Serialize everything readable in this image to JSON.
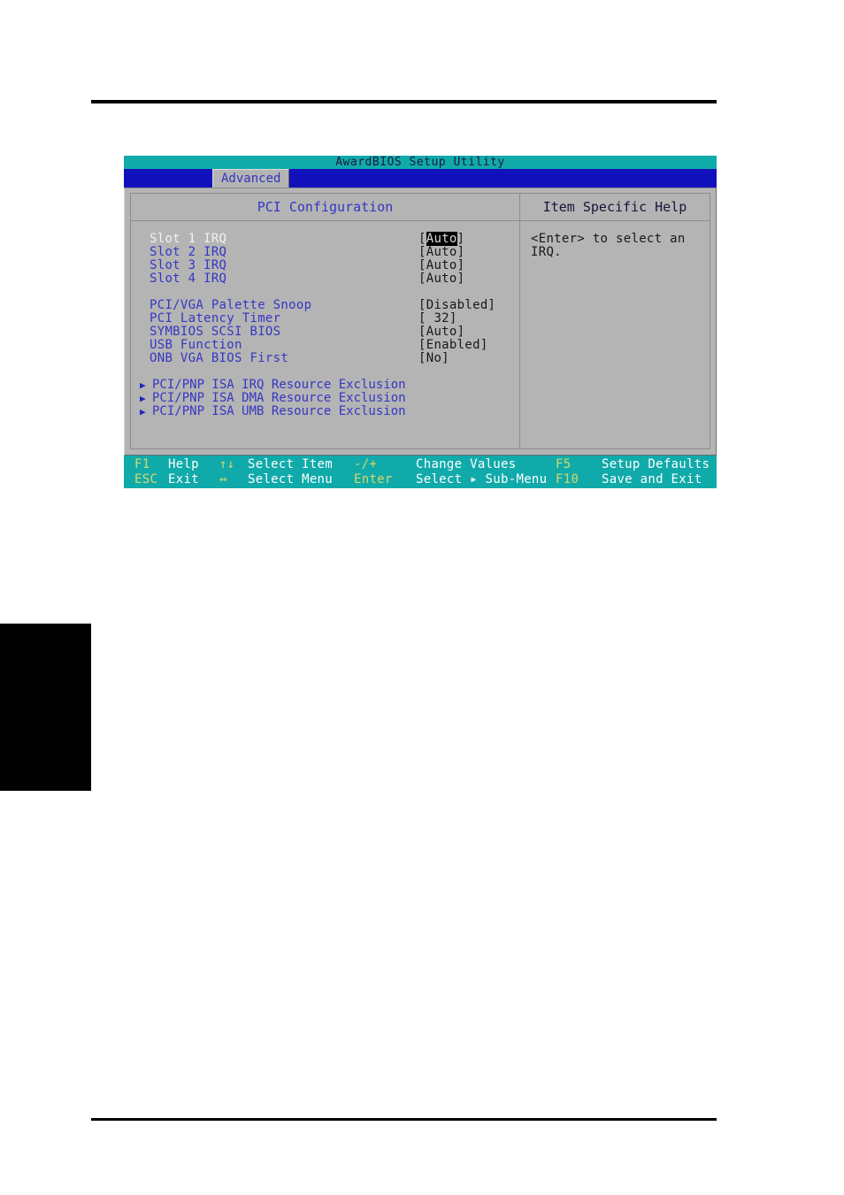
{
  "window": {
    "title": "AwardBIOS Setup Utility",
    "menu_tab": "Advanced"
  },
  "panels": {
    "left_header": "PCI Configuration",
    "right_header": "Item Specific Help"
  },
  "settings": [
    {
      "label": "Slot 1 IRQ",
      "value": "Auto",
      "value_display": "[Auto]",
      "selected": true
    },
    {
      "label": "Slot 2 IRQ",
      "value": "Auto",
      "value_display": "[Auto]",
      "selected": false
    },
    {
      "label": "Slot 3 IRQ",
      "value": "Auto",
      "value_display": "[Auto]",
      "selected": false
    },
    {
      "label": "Slot 4 IRQ",
      "value": "Auto",
      "value_display": "[Auto]",
      "selected": false
    },
    {
      "label": "PCI/VGA Palette Snoop",
      "value": "Disabled",
      "value_display": "[Disabled]",
      "selected": false
    },
    {
      "label": "PCI Latency Timer",
      "value": "32",
      "value_display": "[  32]",
      "selected": false
    },
    {
      "label": "SYMBIOS SCSI BIOS",
      "value": "Auto",
      "value_display": "[Auto]",
      "selected": false
    },
    {
      "label": "USB Function",
      "value": "Enabled",
      "value_display": "[Enabled]",
      "selected": false
    },
    {
      "label": "ONB VGA BIOS First",
      "value": "No",
      "value_display": "[No]",
      "selected": false
    }
  ],
  "submenus": [
    {
      "arrow": "submenu-arrow-icon",
      "label": "PCI/PNP ISA IRQ Resource Exclusion"
    },
    {
      "arrow": "submenu-arrow-icon",
      "label": "PCI/PNP ISA DMA Resource Exclusion"
    },
    {
      "arrow": "submenu-arrow-icon",
      "label": "PCI/PNP ISA UMB Resource Exclusion"
    }
  ],
  "help": {
    "text": "<Enter> to select an\nIRQ."
  },
  "keybar": {
    "row1": [
      {
        "key": "F1",
        "label": "Help"
      },
      {
        "key": "↑↓",
        "label": "Select Item"
      },
      {
        "key": "-/+",
        "label": "Change Values"
      },
      {
        "key": "F5",
        "label": "Setup Defaults"
      }
    ],
    "row2": [
      {
        "key": "ESC",
        "label": "Exit"
      },
      {
        "key": "↔",
        "label": "Select Menu"
      },
      {
        "key": "Enter",
        "label": "Select ▸ Sub-Menu"
      },
      {
        "key": "F10",
        "label": "Save and Exit"
      }
    ]
  },
  "colors": {
    "teal": "#11aaaa",
    "blue_bar": "#1111bb",
    "panel_gray": "#b4b4b4",
    "label_blue": "#3636c4",
    "key_yellow": "#d8d86a",
    "selected_label": "#f2f2f2"
  }
}
